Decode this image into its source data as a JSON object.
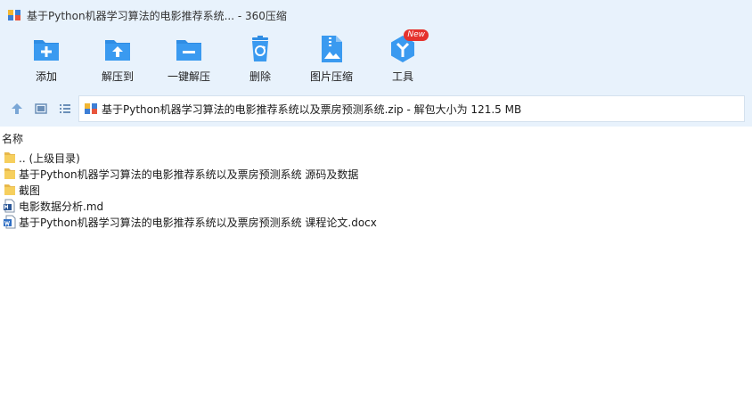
{
  "window": {
    "title": "基于Python机器学习算法的电影推荐系统... - 360压缩"
  },
  "toolbar": {
    "items": [
      {
        "label": "添加",
        "icon": "add-folder-icon"
      },
      {
        "label": "解压到",
        "icon": "extract-folder-icon"
      },
      {
        "label": "一键解压",
        "icon": "one-click-extract-icon"
      },
      {
        "label": "删除",
        "icon": "recycle-bin-icon"
      },
      {
        "label": "图片压缩",
        "icon": "image-compress-icon"
      },
      {
        "label": "工具",
        "icon": "tools-icon",
        "badge": "New"
      }
    ]
  },
  "navbar": {
    "path": "基于Python机器学习算法的电影推荐系统以及票房预测系统.zip - 解包大小为 121.5 MB"
  },
  "list": {
    "column_name": "名称",
    "items": [
      {
        "name": ".. (上级目录)",
        "type": "folder"
      },
      {
        "name": "基于Python机器学习算法的电影推荐系统以及票房预测系统 源码及数据",
        "type": "folder"
      },
      {
        "name": "截图",
        "type": "folder"
      },
      {
        "name": "电影数据分析.md",
        "type": "md"
      },
      {
        "name": "基于Python机器学习算法的电影推荐系统以及票房预测系统 课程论文.docx",
        "type": "docx"
      }
    ]
  },
  "colors": {
    "chrome_bg": "#e8f2fc",
    "icon_blue": "#2f8de4",
    "folder_yellow": "#f6c94a",
    "badge_red": "#e5322d"
  }
}
